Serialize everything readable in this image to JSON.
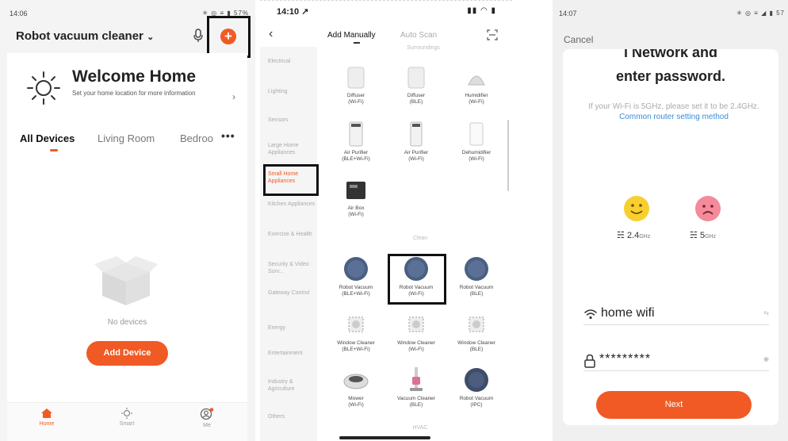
{
  "panel1": {
    "status_time": "14:06",
    "status_icons": "✳ ◎ ≡ ▮ 57%",
    "header_title": "Robot vacuum cleaner",
    "welcome_title": "Welcome Home",
    "location_hint": "Set your home location for more information",
    "tabs": [
      "All Devices",
      "Living Room",
      "Bedroo"
    ],
    "more_label": "•••",
    "no_devices_label": "No devices",
    "add_device_label": "Add Device",
    "nav": [
      {
        "label": "Home",
        "icon": "home-icon"
      },
      {
        "label": "Smart",
        "icon": "smart-icon"
      },
      {
        "label": "Me",
        "icon": "profile-icon"
      }
    ],
    "accent_color": "#f15a24"
  },
  "panel2": {
    "status_time": "14:10 ↗",
    "status_icons": "▮▮ ◠ ▮",
    "tab_manual": "Add Manually",
    "tab_auto": "Auto Scan",
    "categories": [
      "Electrical",
      "Lighting",
      "Sensors",
      "Large Home Appliances",
      "Small Home Appliances",
      "Kitchen Appliances",
      "Exercise & Health",
      "Security & Video Surv...",
      "Gateway Control",
      "Energy",
      "Entertainment",
      "Industry & Agriculture",
      "Others"
    ],
    "active_category": "Small Home Appliances",
    "section_surroundings": "Surroundings",
    "section_clean": "Clean",
    "section_hvac": "HVAC",
    "devices": [
      {
        "name": "Diffuser",
        "proto": "(Wi-Fi)"
      },
      {
        "name": "Diffuser",
        "proto": "(BLE)"
      },
      {
        "name": "Humidifier",
        "proto": "(Wi-Fi)"
      },
      {
        "name": "Air Purifier",
        "proto": "(BLE+Wi-Fi)"
      },
      {
        "name": "Air Purifier",
        "proto": "(Wi-Fi)"
      },
      {
        "name": "Dehumidifier",
        "proto": "(Wi-Fi)"
      },
      {
        "name": "Air Box",
        "proto": "(Wi-Fi)"
      },
      {
        "name": "Robot Vacuum",
        "proto": "(BLE+Wi-Fi)"
      },
      {
        "name": "Robot Vacuum",
        "proto": "(Wi-Fi)"
      },
      {
        "name": "Robot Vacuum",
        "proto": "(BLE)"
      },
      {
        "name": "Window Cleaner",
        "proto": "(BLE+Wi-Fi)"
      },
      {
        "name": "Window Cleaner",
        "proto": "(Wi-Fi)"
      },
      {
        "name": "Window Cleaner",
        "proto": "(BLE)"
      },
      {
        "name": "Mower",
        "proto": "(Wi-Fi)"
      },
      {
        "name": "Vacuum Cleaner",
        "proto": "(BLE)"
      },
      {
        "name": "Robot Vacuum",
        "proto": "(IPC)"
      }
    ]
  },
  "panel3": {
    "status_time": "14:07",
    "status_icons": "✳ ◎ ≡ ◢ ▮ 57",
    "cancel_label": "Cancel",
    "title_line1": "i Network and",
    "title_line2": "enter password.",
    "hint_text": "If your Wi-Fi is 5GHz, please set it to be 2.4GHz.",
    "hint_link": "Common router setting method",
    "band_24": "2.4",
    "band_24_unit": "GHz",
    "band_5": "5",
    "band_5_unit": "GHz",
    "wifi_name": "home wifi",
    "wifi_right": "⇆",
    "password": "*********",
    "password_right": "◉",
    "next_label": "Next"
  }
}
